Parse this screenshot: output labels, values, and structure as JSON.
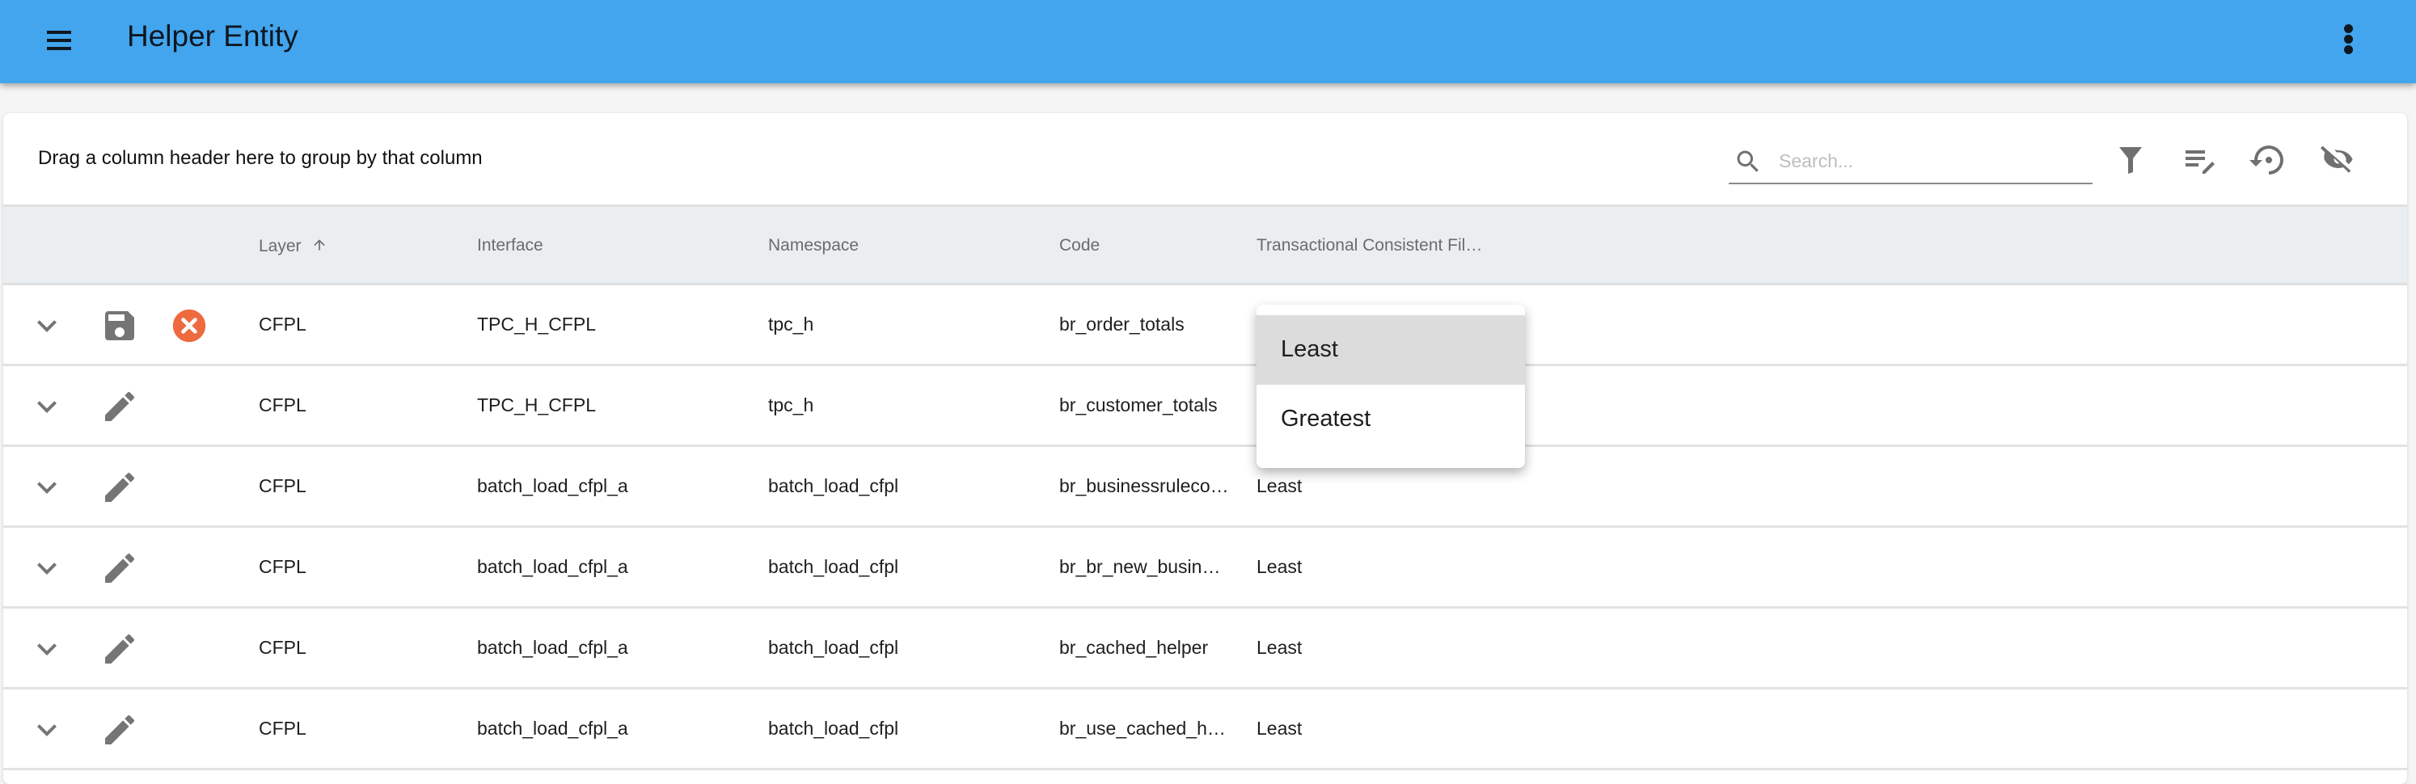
{
  "appbar": {
    "title": "Helper Entity",
    "color": "#42a5ee",
    "menu_icon": "hamburger-menu-icon",
    "more_icon": "more-vert-icon"
  },
  "toolbar": {
    "group_hint": "Drag a column header here to group by that column",
    "search": {
      "placeholder": "Search...",
      "value": ""
    },
    "buttons": [
      {
        "name": "filter",
        "icon": "filter-icon"
      },
      {
        "name": "edit-columns",
        "icon": "playlist-edit-icon"
      },
      {
        "name": "restore",
        "icon": "restore-icon"
      },
      {
        "name": "hide-columns",
        "icon": "visibility-off-icon"
      }
    ]
  },
  "table": {
    "columns": [
      {
        "key": "layer",
        "label": "Layer",
        "sort": "ascending"
      },
      {
        "key": "interface",
        "label": "Interface"
      },
      {
        "key": "namespace",
        "label": "Namespace"
      },
      {
        "key": "code",
        "label": "Code"
      },
      {
        "key": "tcf",
        "label": "Transactional Consistent Fil…"
      }
    ],
    "rows": [
      {
        "mode": "editing",
        "layer": "CFPL",
        "interface": "TPC_H_CFPL",
        "namespace": "tpc_h",
        "code": "br_order_totals",
        "tcf": ""
      },
      {
        "mode": "view",
        "layer": "CFPL",
        "interface": "TPC_H_CFPL",
        "namespace": "tpc_h",
        "code": "br_customer_totals",
        "tcf": ""
      },
      {
        "mode": "view",
        "layer": "CFPL",
        "interface": "batch_load_cfpl_a",
        "namespace": "batch_load_cfpl",
        "code": "br_businessruleco…",
        "tcf": "Least"
      },
      {
        "mode": "view",
        "layer": "CFPL",
        "interface": "batch_load_cfpl_a",
        "namespace": "batch_load_cfpl",
        "code": "br_br_new_busin…",
        "tcf": "Least"
      },
      {
        "mode": "view",
        "layer": "CFPL",
        "interface": "batch_load_cfpl_a",
        "namespace": "batch_load_cfpl",
        "code": "br_cached_helper",
        "tcf": "Least"
      },
      {
        "mode": "view",
        "layer": "CFPL",
        "interface": "batch_load_cfpl_a",
        "namespace": "batch_load_cfpl",
        "code": "br_use_cached_h…",
        "tcf": "Least"
      }
    ]
  },
  "dropdown": {
    "options": [
      "Least",
      "Greatest"
    ],
    "highlighted": "Least"
  },
  "colors": {
    "cancel": "#ee6a3f",
    "icon": "#757575",
    "header_bg": "#ebeef1"
  }
}
